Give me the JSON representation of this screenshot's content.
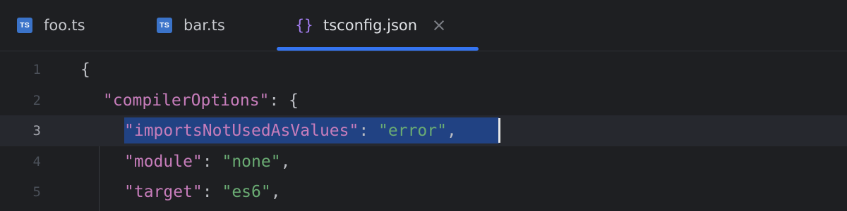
{
  "tabs": [
    {
      "label": "foo.ts",
      "icon": "ts-icon",
      "icon_text": "TS",
      "active": false
    },
    {
      "label": "bar.ts",
      "icon": "ts-icon",
      "icon_text": "TS",
      "active": false
    },
    {
      "label": "tsconfig.json",
      "icon": "json-braces-icon",
      "icon_text": "{}",
      "active": true,
      "closable": true
    }
  ],
  "editor": {
    "file": "tsconfig.json",
    "current_line": 3,
    "selected_text": "\"importsNotUsedAsValues\": \"error\",",
    "lines": [
      {
        "number": "1",
        "tokens": [
          {
            "t": "{",
            "k": "punct"
          }
        ]
      },
      {
        "number": "2",
        "tokens": [
          {
            "t": "\"compilerOptions\"",
            "k": "key"
          },
          {
            "t": ": {",
            "k": "punct"
          }
        ]
      },
      {
        "number": "3",
        "tokens": [
          {
            "t": "\"importsNotUsedAsValues\"",
            "k": "key"
          },
          {
            "t": ": ",
            "k": "punct"
          },
          {
            "t": "\"error\"",
            "k": "str"
          },
          {
            "t": ",",
            "k": "punct"
          }
        ]
      },
      {
        "number": "4",
        "tokens": [
          {
            "t": "\"module\"",
            "k": "key"
          },
          {
            "t": ": ",
            "k": "punct"
          },
          {
            "t": "\"none\"",
            "k": "str"
          },
          {
            "t": ",",
            "k": "punct"
          }
        ]
      },
      {
        "number": "5",
        "tokens": [
          {
            "t": "\"target\"",
            "k": "key"
          },
          {
            "t": ": ",
            "k": "punct"
          },
          {
            "t": "\"es6\"",
            "k": "str"
          },
          {
            "t": ",",
            "k": "punct"
          }
        ]
      }
    ]
  },
  "colors": {
    "background": "#1e1f22",
    "active_tab_underline": "#3574f0",
    "ts_icon": "#3b73c9",
    "json_icon": "#a47ef2",
    "json_key": "#c77dbb",
    "json_string": "#6aab73",
    "selection": "#214283",
    "current_line": "#26282e"
  }
}
